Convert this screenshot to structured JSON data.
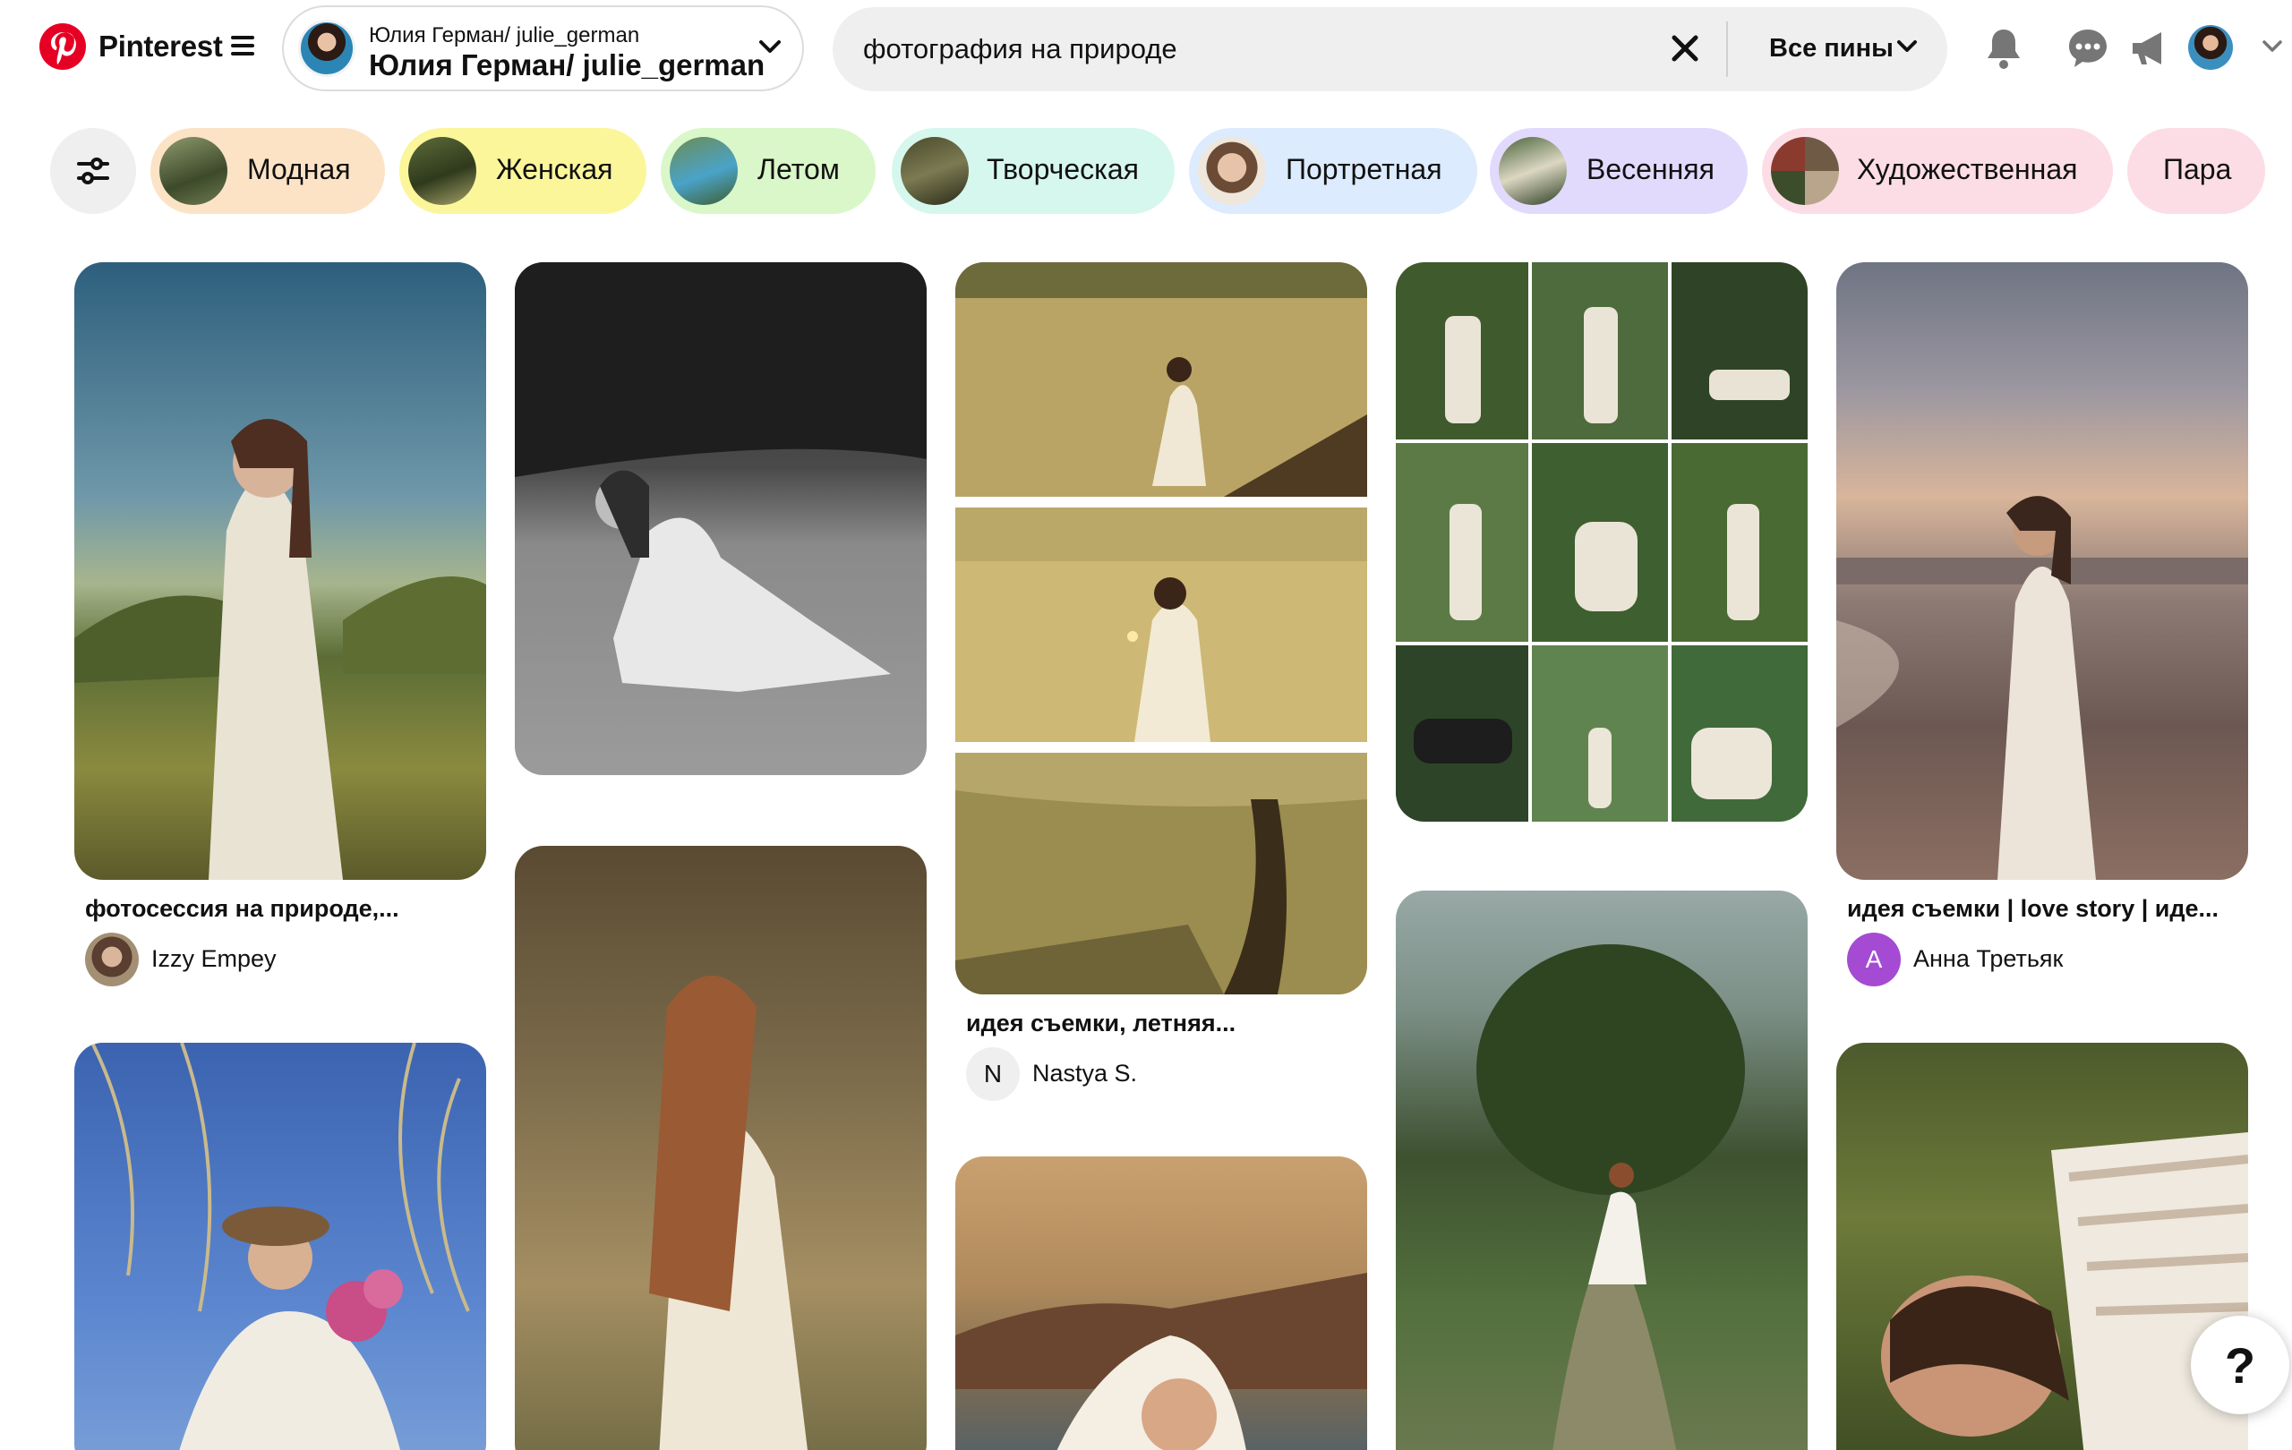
{
  "app": {
    "brand": "Pinterest"
  },
  "account": {
    "top_line": "Юлия Герман/ julie_german",
    "main_line": "Юлия Герман/ julie_german"
  },
  "search": {
    "query": "фотография на природе",
    "scope": "Все пины"
  },
  "chips": [
    {
      "label": "Модная",
      "color": "#fce3c6"
    },
    {
      "label": "Женская",
      "color": "#fbf69a"
    },
    {
      "label": "Летом",
      "color": "#d9f7c8"
    },
    {
      "label": "Творческая",
      "color": "#d6f7ee"
    },
    {
      "label": "Портретная",
      "color": "#dcebfd"
    },
    {
      "label": "Весенняя",
      "color": "#e2dafd"
    },
    {
      "label": "Художественная",
      "color": "#fcdde6"
    },
    {
      "label": "Пара",
      "color": "#fcdde6"
    }
  ],
  "pins": [
    {
      "title": "фотосессия на природе,...",
      "author": "Izzy Empey"
    },
    {
      "title": "идея съемки, летняя...",
      "author": "Nastya S.",
      "author_initial": "N"
    },
    {
      "title": "идея съемки | love story | иде...",
      "author": "Анна Третьяк",
      "author_initial": "A"
    }
  ],
  "icons": [
    "pinterest-logo-icon",
    "menu-icon",
    "chevron-down-icon",
    "close-icon",
    "bell-icon",
    "chat-icon",
    "megaphone-icon",
    "filter-icon"
  ],
  "help": {
    "label": "?"
  },
  "colors": {
    "brand": "#e60023",
    "search_bg": "#efefef",
    "author_purple": "#a54bd3"
  }
}
